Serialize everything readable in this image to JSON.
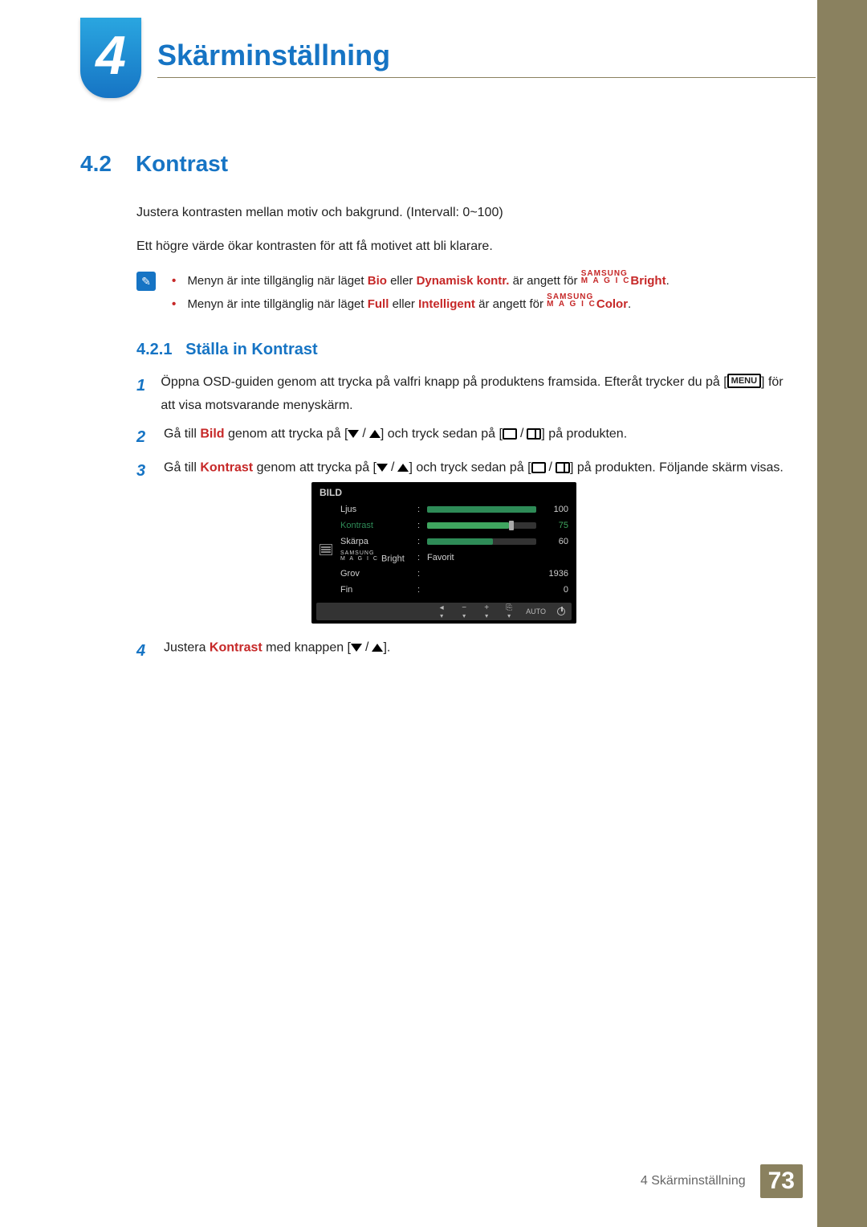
{
  "chapter": {
    "number": "4",
    "title": "Skärminställning"
  },
  "section": {
    "number": "4.2",
    "title": "Kontrast"
  },
  "intro": {
    "p1": "Justera kontrasten mellan motiv och bakgrund. (Intervall: 0~100)",
    "p2": "Ett högre värde ökar kontrasten för att få motivet att bli klarare."
  },
  "notes": {
    "n1_a": "Menyn är inte tillgänglig när läget ",
    "n1_bio": "Bio",
    "n1_b": " eller ",
    "n1_dyn": "Dynamisk kontr.",
    "n1_c": " är angett för ",
    "n1_magic_top": "SAMSUNG",
    "n1_magic_bot": "M A G I C",
    "n1_suffix": "Bright",
    "n1_end": ".",
    "n2_a": "Menyn är inte tillgänglig när läget ",
    "n2_full": "Full",
    "n2_b": " eller ",
    "n2_int": "Intelligent",
    "n2_c": " är angett för ",
    "n2_suffix": "Color",
    "n2_end": "."
  },
  "subsection": {
    "number": "4.2.1",
    "title": "Ställa in Kontrast"
  },
  "steps": {
    "s1_a": "Öppna OSD-guiden genom att trycka på valfri knapp på produktens framsida. Efteråt trycker du på [",
    "s1_menu": "MENU",
    "s1_b": "] för att visa motsvarande menyskärm.",
    "s2_a": "Gå till ",
    "s2_bild": "Bild",
    "s2_b": " genom att trycka på [",
    "s2_c": "] och tryck sedan på [",
    "s2_d": "] på produkten.",
    "s3_a": "Gå till ",
    "s3_k": "Kontrast",
    "s3_b": " genom att trycka på [",
    "s3_c": "] och tryck sedan på [",
    "s3_d": "] på produkten. Följande skärm visas.",
    "s4_a": "Justera ",
    "s4_k": "Kontrast",
    "s4_b": " med knappen [",
    "s4_c": "]."
  },
  "osd": {
    "title": "BILD",
    "rows": {
      "ljus": {
        "label": "Ljus",
        "value": "100",
        "fill": 100
      },
      "kontrast": {
        "label": "Kontrast",
        "value": "75",
        "fill": 75
      },
      "skarpa": {
        "label": "Skärpa",
        "value": "60",
        "fill": 60
      },
      "magic": {
        "top": "SAMSUNG",
        "bot": "M A G I C",
        "suffix": " Bright",
        "text": "Favorit"
      },
      "grov": {
        "label": "Grov",
        "value": "1936"
      },
      "fin": {
        "label": "Fin",
        "value": "0"
      }
    },
    "footer": {
      "auto": "AUTO"
    }
  },
  "footer": {
    "text": "4 Skärminställning",
    "page": "73"
  }
}
